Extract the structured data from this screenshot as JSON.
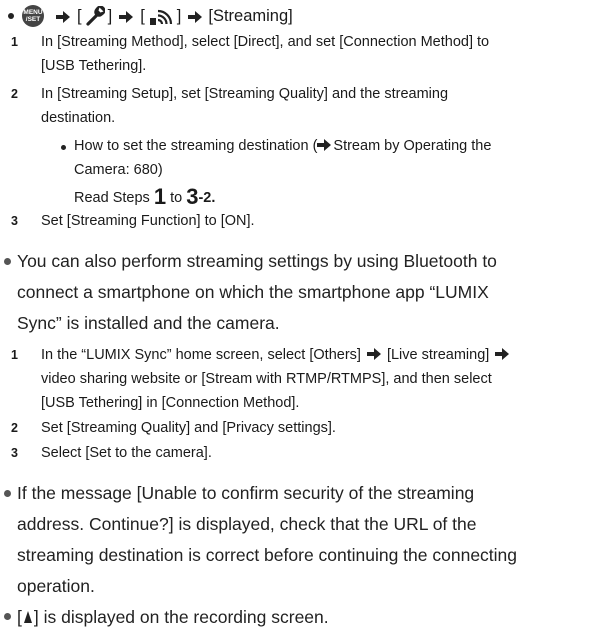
{
  "menu_path": {
    "menu_icon_label": "MENU/SET",
    "step_streaming": "[Streaming]"
  },
  "steps_a": [
    {
      "num": "1",
      "line1": "In [Streaming Method], select [Direct], and set [Connection Method] to",
      "line2": "[USB Tethering]."
    },
    {
      "num": "2",
      "line1": "In [Streaming Setup], set [Streaming Quality] and the streaming",
      "line2": "destination."
    },
    {
      "num": "3",
      "line1": "Set [Streaming Function] to [ON]."
    }
  ],
  "sub_note": {
    "line1": "How to set the streaming destination (",
    "link": "Stream by Operating the",
    "line2": "Camera: 680)",
    "read_prefix": "Read Steps ",
    "read_num1": "1",
    "read_to": " to ",
    "read_num2": "3",
    "read_suffix": "-2."
  },
  "bullet1": {
    "line1": "You can also perform streaming settings by using Bluetooth to",
    "line2": "connect a smartphone on which the smartphone app “LUMIX",
    "line3": "Sync” is installed and the camera."
  },
  "steps_b": [
    {
      "num": "1",
      "line1": "In the “LUMIX Sync” home screen, select [Others]",
      "line1b": "[Live streaming]",
      "line2": "video sharing website or [Stream with RTMP/RTMPS], and then select",
      "line3": "[USB Tethering] in [Connection Method]."
    },
    {
      "num": "2",
      "line1": "Set [Streaming Quality] and [Privacy settings]."
    },
    {
      "num": "3",
      "line1": "Select [Set to the camera]."
    }
  ],
  "bullet2": {
    "line1": "If the message [Unable to confirm security of the streaming",
    "line2": "address. Continue?] is displayed, check that the URL of the",
    "line3": "streaming destination is correct before continuing the connecting",
    "line4": "operation."
  },
  "bullet3": {
    "prefix": "[",
    "suffix": "] is displayed on the recording screen."
  }
}
